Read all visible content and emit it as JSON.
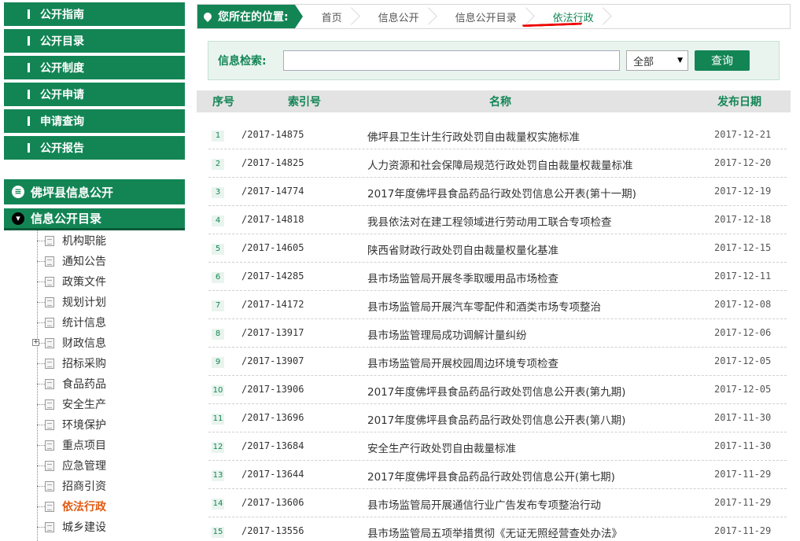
{
  "sidebar": {
    "menu": [
      {
        "label": "公开指南"
      },
      {
        "label": "公开目录"
      },
      {
        "label": "公开制度"
      },
      {
        "label": "公开申请"
      },
      {
        "label": "申请查询"
      },
      {
        "label": "公开报告"
      }
    ],
    "section1": "佛坪县信息公开",
    "section2": "信息公开目录",
    "tree": [
      {
        "label": "机构职能"
      },
      {
        "label": "通知公告"
      },
      {
        "label": "政策文件"
      },
      {
        "label": "规划计划"
      },
      {
        "label": "统计信息"
      },
      {
        "label": "财政信息"
      },
      {
        "label": "招标采购"
      },
      {
        "label": "食品药品"
      },
      {
        "label": "安全生产"
      },
      {
        "label": "环境保护"
      },
      {
        "label": "重点项目"
      },
      {
        "label": "应急管理"
      },
      {
        "label": "招商引资"
      },
      {
        "label": "依法行政"
      },
      {
        "label": "城乡建设"
      }
    ]
  },
  "breadcrumb": {
    "label": "您所在的位置:",
    "items": [
      "首页",
      "信息公开",
      "信息公开目录",
      "依法行政"
    ]
  },
  "search": {
    "label": "信息检索:",
    "value": "",
    "select": "全部",
    "button": "查询"
  },
  "table": {
    "headers": {
      "num": "序号",
      "idx": "索引号",
      "name": "名称",
      "date": "发布日期"
    },
    "rows": [
      {
        "num": "1",
        "idx": "/2017-14875",
        "name": "佛坪县卫生计生行政处罚自由裁量权实施标准",
        "date": "2017-12-21"
      },
      {
        "num": "2",
        "idx": "/2017-14825",
        "name": "人力资源和社会保障局规范行政处罚自由裁量权裁量标准",
        "date": "2017-12-20"
      },
      {
        "num": "3",
        "idx": "/2017-14774",
        "name": "2017年度佛坪县食品药品行政处罚信息公开表(第十一期)",
        "date": "2017-12-19"
      },
      {
        "num": "4",
        "idx": "/2017-14818",
        "name": "我县依法对在建工程领域进行劳动用工联合专项检查",
        "date": "2017-12-18"
      },
      {
        "num": "5",
        "idx": "/2017-14605",
        "name": "陕西省财政行政处罚自由裁量权量化基准",
        "date": "2017-12-15"
      },
      {
        "num": "6",
        "idx": "/2017-14285",
        "name": "县市场监管局开展冬季取暖用品市场检查",
        "date": "2017-12-11"
      },
      {
        "num": "7",
        "idx": "/2017-14172",
        "name": "县市场监管局开展汽车零配件和酒类市场专项整治",
        "date": "2017-12-08"
      },
      {
        "num": "8",
        "idx": "/2017-13917",
        "name": "县市场监管理局成功调解计量纠纷",
        "date": "2017-12-06"
      },
      {
        "num": "9",
        "idx": "/2017-13907",
        "name": "县市场监管局开展校园周边环境专项检查",
        "date": "2017-12-05"
      },
      {
        "num": "10",
        "idx": "/2017-13906",
        "name": "2017年度佛坪县食品药品行政处罚信息公开表(第九期)",
        "date": "2017-12-05"
      },
      {
        "num": "11",
        "idx": "/2017-13696",
        "name": "2017年度佛坪县食品药品行政处罚信息公开表(第八期)",
        "date": "2017-11-30"
      },
      {
        "num": "12",
        "idx": "/2017-13684",
        "name": "安全生产行政处罚自由裁量标准",
        "date": "2017-11-30"
      },
      {
        "num": "13",
        "idx": "/2017-13644",
        "name": "2017年度佛坪县食品药品行政处罚信息公开(第七期)",
        "date": "2017-11-29"
      },
      {
        "num": "14",
        "idx": "/2017-13606",
        "name": "县市场监管局开展通信行业广告发布专项整治行动",
        "date": "2017-11-29"
      },
      {
        "num": "15",
        "idx": "/2017-13556",
        "name": "县市场监管局五项举措贯彻《无证无照经营查处办法》",
        "date": "2017-11-29"
      }
    ]
  }
}
